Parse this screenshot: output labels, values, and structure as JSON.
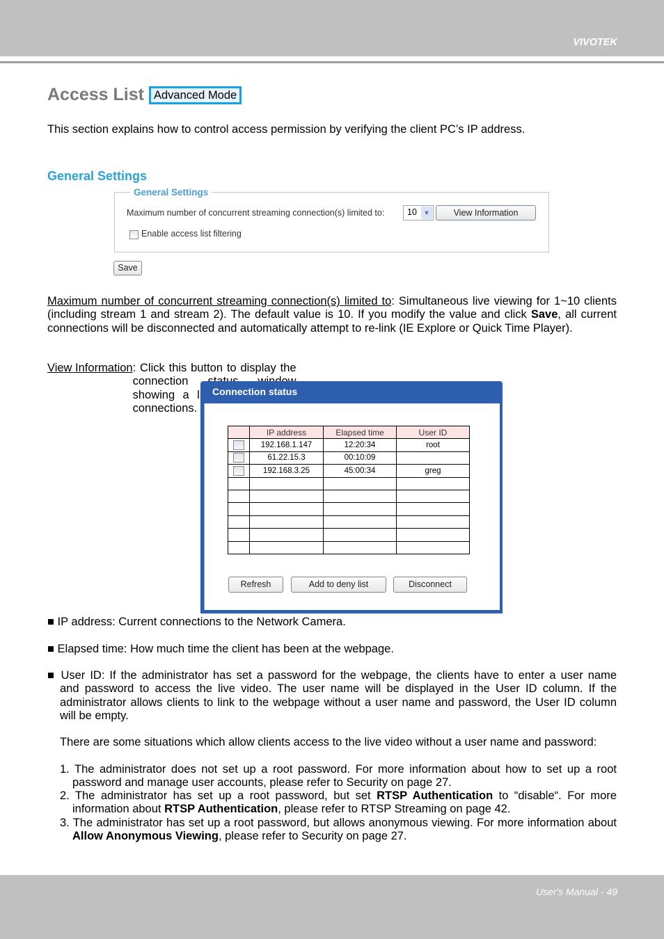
{
  "header": {
    "brand": "VIVOTEK"
  },
  "footer": {
    "page_label": "User's Manual - 49"
  },
  "title": {
    "text": "Access List",
    "badge": "Advanced Mode"
  },
  "intro": "This section explains how to control access permission by verifying the client PC’s IP address.",
  "general_settings": {
    "heading": "General Settings",
    "panel_legend": "General Settings",
    "max_label": "Maximum number of concurrent streaming connection(s) limited to:",
    "max_value": "10",
    "view_info_button": "View Information",
    "enable_filter_label": "Enable access list filtering",
    "enable_filter_checked": false,
    "save_button": "Save"
  },
  "max_paragraph": {
    "term": "Maximum number of concurrent streaming connection(s) limited to",
    "text_a": ": Simultaneous live viewing for 1~10 clients (including stream 1 and stream 2). The default value is 10. If you modify the value and click ",
    "bold": "Save",
    "text_b": ", all current connections will be disconnected and automatically attempt to re-link (IE Explore or Quick Time Player)."
  },
  "view_paragraph": {
    "term": "View Information",
    "text": ": Click this button to display the connection status window showing a list of the current connections. For example:"
  },
  "connection_status": {
    "title": "Connection status",
    "columns": [
      "",
      "IP address",
      "Elapsed time",
      "User ID"
    ],
    "rows": [
      {
        "ip": "192.168.1.147",
        "elapsed": "12:20:34",
        "user": "root"
      },
      {
        "ip": "61.22.15.3",
        "elapsed": "00:10:09",
        "user": ""
      },
      {
        "ip": "192.168.3.25",
        "elapsed": "45:00:34",
        "user": "greg"
      },
      {
        "ip": "",
        "elapsed": "",
        "user": ""
      },
      {
        "ip": "",
        "elapsed": "",
        "user": ""
      },
      {
        "ip": "",
        "elapsed": "",
        "user": ""
      },
      {
        "ip": "",
        "elapsed": "",
        "user": ""
      },
      {
        "ip": "",
        "elapsed": "",
        "user": ""
      },
      {
        "ip": "",
        "elapsed": "",
        "user": ""
      }
    ],
    "buttons": {
      "refresh": "Refresh",
      "deny": "Add to deny list",
      "disconnect": "Disconnect"
    }
  },
  "bullets": {
    "ip": "■ IP address: Current connections to the Network Camera.",
    "elapsed": "■ Elapsed time: How much time the client has been at the webpage.",
    "userid_lead": "■ User ID: If the administrator has set a password for the webpage, the clients have to enter a user name",
    "userid_rest": "and password to access the live video. The user name will be displayed in the User ID column. If the administrator allows clients to link to the webpage without a user name and password, the User ID column will be empty."
  },
  "situations": {
    "intro": "There are some situations which allow clients access to the live video without a user name and password:",
    "item1": "1. The administrator does not set up a root password. For more information about how to set up a root password and manage user accounts, please refer to Security on page 27.",
    "item2_a": "2. The administrator has set up a root password, but set ",
    "item2_b1": "RTSP Authentication",
    "item2_c": " to “disable“. For more information about ",
    "item2_b2": "RTSP Authentication",
    "item2_d": ", please refer to RTSP Streaming on page 42.",
    "item3_a": "3. The administrator has set up a root password, but allows anonymous viewing. For more information about ",
    "item3_b": "Allow Anonymous Viewing",
    "item3_c": ", please refer to Security on page 27."
  }
}
